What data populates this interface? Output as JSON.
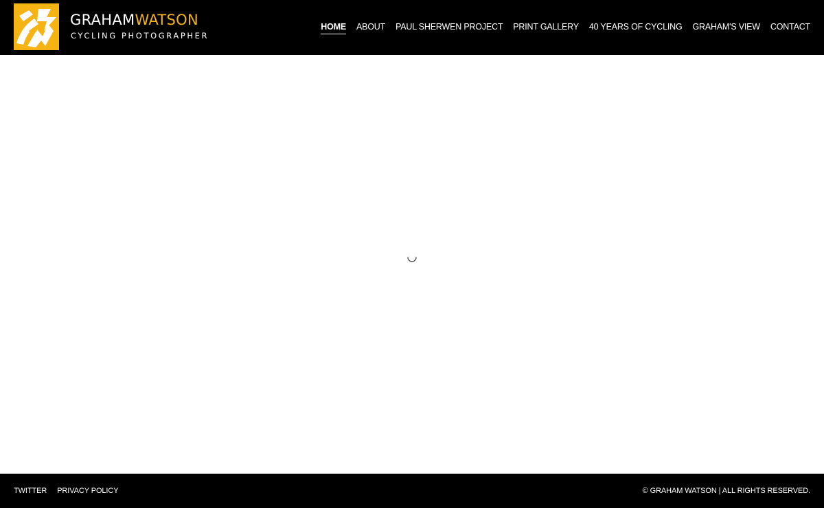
{
  "brand": {
    "name_first": "GRAHAM",
    "name_last": "WATSON",
    "tagline": "CYCLING PHOTOGRAPHER",
    "accent_color": "#f5b414",
    "logo_icon": "gw-monogram-logo"
  },
  "nav": {
    "items": [
      {
        "label": "HOME",
        "active": true
      },
      {
        "label": "ABOUT",
        "active": false
      },
      {
        "label": "PAUL SHERWEN PROJECT",
        "active": false
      },
      {
        "label": "PRINT GALLERY",
        "active": false
      },
      {
        "label": "40 YEARS OF CYCLING",
        "active": false
      },
      {
        "label": "GRAHAM'S VIEW",
        "active": false
      },
      {
        "label": "CONTACT",
        "active": false
      }
    ]
  },
  "main": {
    "loading_icon": "loading-spinner-icon"
  },
  "footer": {
    "links": [
      {
        "label": "TWITTER"
      },
      {
        "label": "PRIVACY POLICY"
      }
    ],
    "copyright": "© GRAHAM WATSON | ALL RIGHTS RESERVED."
  },
  "colors": {
    "header_bg": "#000000",
    "footer_bg": "#000000",
    "page_bg": "#ffffff",
    "text_on_dark": "#ffffff"
  }
}
